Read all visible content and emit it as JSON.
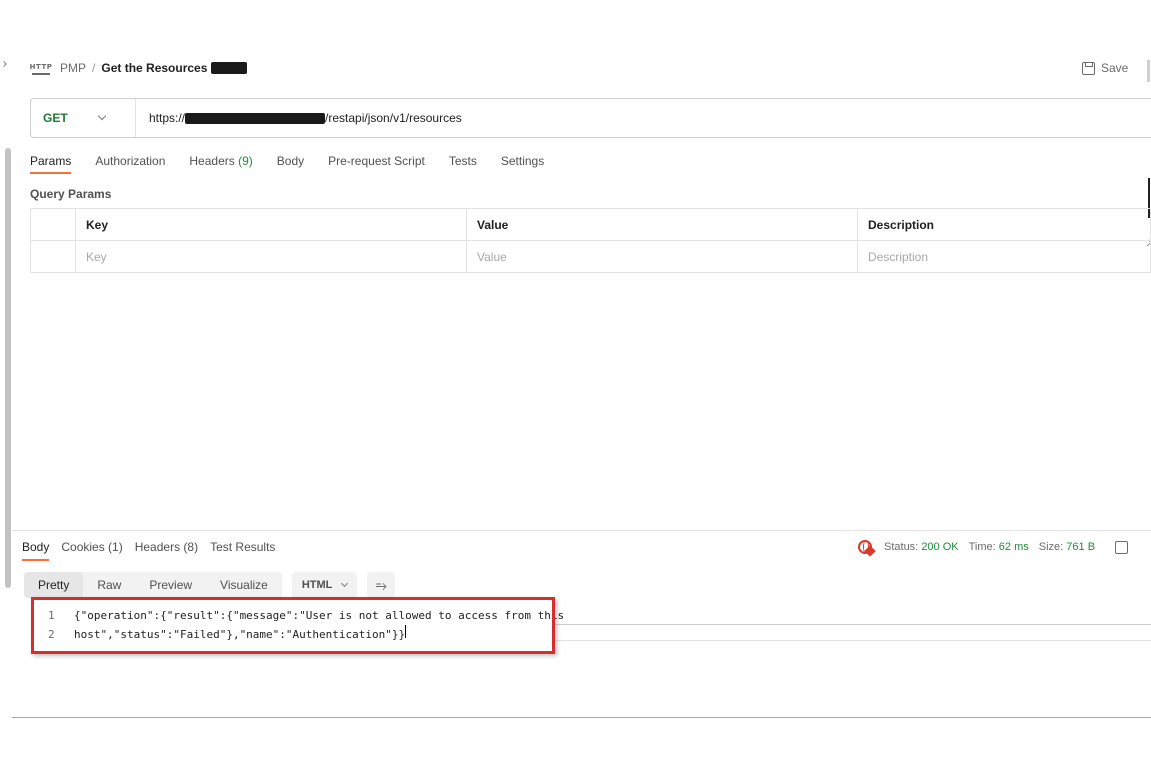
{
  "header": {
    "http_icon_text": "HTTP",
    "collection": "PMP",
    "separator": "/",
    "request_name": "Get the Resources",
    "save_label": "Save"
  },
  "url_bar": {
    "method": "GET",
    "url_prefix": "https://",
    "url_suffix": "/restapi/json/v1/resources"
  },
  "request_tabs": [
    {
      "label": "Params",
      "count": "",
      "active": true
    },
    {
      "label": "Authorization",
      "count": ""
    },
    {
      "label": "Headers",
      "count": "(9)"
    },
    {
      "label": "Body",
      "count": ""
    },
    {
      "label": "Pre-request Script",
      "count": ""
    },
    {
      "label": "Tests",
      "count": ""
    },
    {
      "label": "Settings",
      "count": ""
    }
  ],
  "query_params": {
    "title": "Query Params",
    "columns": [
      "Key",
      "Value",
      "Description"
    ],
    "placeholders": [
      "Key",
      "Value",
      "Description"
    ]
  },
  "response": {
    "tabs": [
      {
        "label": "Body",
        "active": true
      },
      {
        "label": "Cookies (1)"
      },
      {
        "label": "Headers (8)"
      },
      {
        "label": "Test Results"
      }
    ],
    "status_label": "Status:",
    "status_value": "200 OK",
    "time_label": "Time:",
    "time_value": "62 ms",
    "size_label": "Size:",
    "size_value": "761 B",
    "view_modes": [
      "Pretty",
      "Raw",
      "Preview",
      "Visualize"
    ],
    "active_view": "Pretty",
    "format": "HTML",
    "wrap_icon": "⥱",
    "code_lines": [
      {
        "n": "1",
        "text": "{\"operation\":{\"result\":{\"message\":\"User is not allowed to access from this"
      },
      {
        "n": "2",
        "text": "host\",\"status\":\"Failed\"},\"name\":\"Authentication\"}}"
      }
    ]
  },
  "colors": {
    "accent_tab": "#ff6c37",
    "method_get": "#1f7a36",
    "status_ok": "#1f8a3b",
    "highlight_box": "#d32f2f"
  }
}
